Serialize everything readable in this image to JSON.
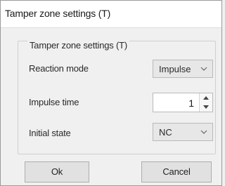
{
  "window": {
    "title": "Tamper zone settings (T)"
  },
  "group": {
    "legend": "Tamper zone settings (T)"
  },
  "fields": {
    "reaction_mode": {
      "label": "Reaction mode",
      "value": "Impulse",
      "arrow_icon": "chevron-down-icon"
    },
    "impulse_time": {
      "label": "Impulse time",
      "value": "1",
      "up_icon": "triangle-up-icon",
      "down_icon": "triangle-down-icon"
    },
    "initial_state": {
      "label": "Initial state",
      "value": "NC",
      "arrow_icon": "chevron-down-icon"
    }
  },
  "buttons": {
    "ok_label": "Ok",
    "cancel_label": "Cancel"
  },
  "colors": {
    "window_bg": "#f0f0f0",
    "titlebar_bg": "#ffffff",
    "button_bg": "#e1e1e1"
  }
}
